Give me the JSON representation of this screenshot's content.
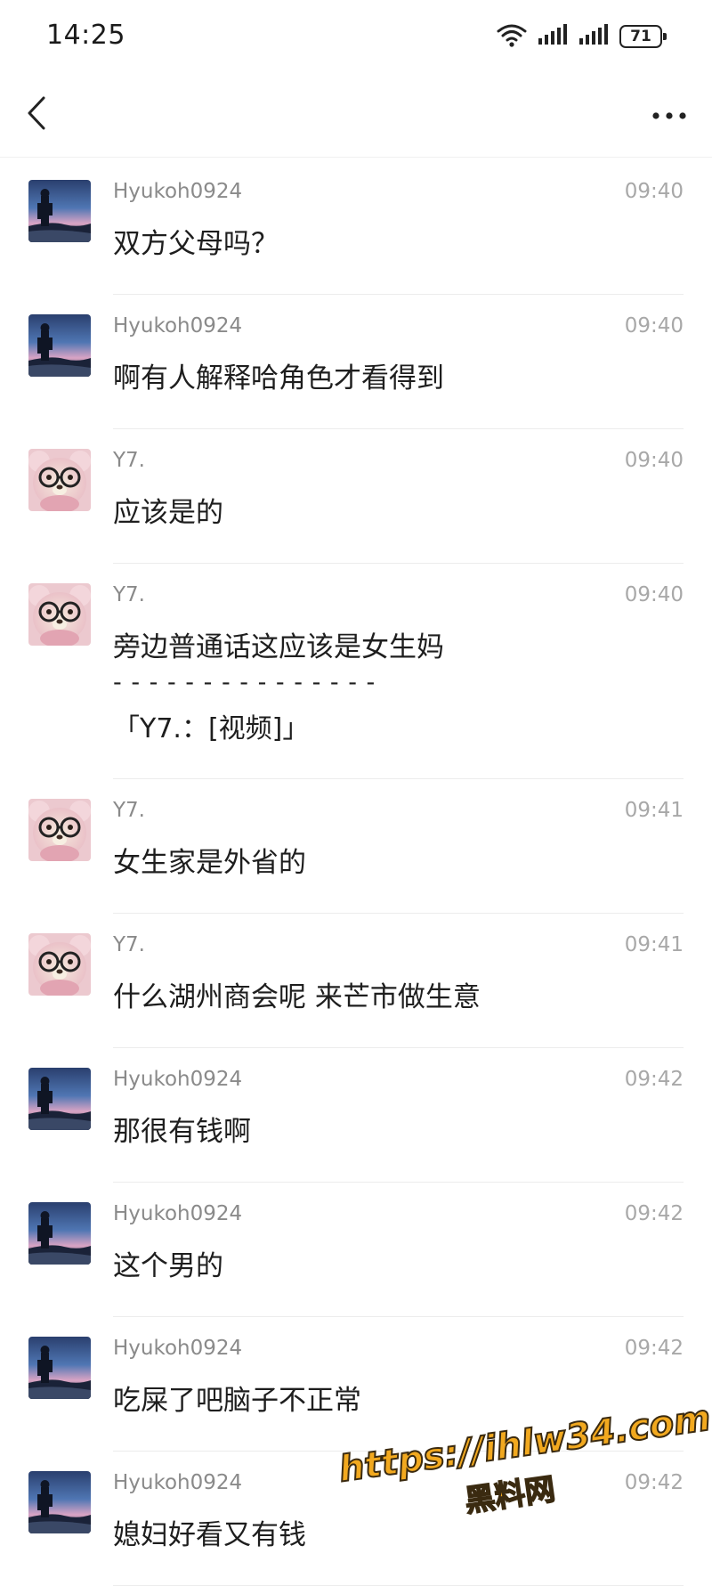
{
  "status_bar": {
    "time": "14:25",
    "battery": "71",
    "icons": [
      "wifi-icon",
      "signal-icon",
      "signal-icon",
      "battery-icon"
    ]
  },
  "nav": {
    "back_icon": "chevron-left-icon",
    "more_icon": "more-horizontal-icon"
  },
  "messages": [
    {
      "avatar": "hyukoh",
      "name": "Hyukoh0924",
      "time": "09:40",
      "text": "双方父母吗？"
    },
    {
      "avatar": "hyukoh",
      "name": "Hyukoh0924",
      "time": "09:40",
      "text": "啊有人解释哈角色才看得到"
    },
    {
      "avatar": "y7",
      "name": "Y7.",
      "time": "09:40",
      "text": "应该是的"
    },
    {
      "avatar": "y7",
      "name": "Y7.",
      "time": "09:40",
      "text": "旁边普通话这应该是女生妈",
      "separator": "- - - - - - - - - - - - - - -",
      "quote": "「Y7.：[视频]」"
    },
    {
      "avatar": "y7",
      "name": "Y7.",
      "time": "09:41",
      "text": "女生家是外省的"
    },
    {
      "avatar": "y7",
      "name": "Y7.",
      "time": "09:41",
      "text": "什么湖州商会呢 来芒市做生意"
    },
    {
      "avatar": "hyukoh",
      "name": "Hyukoh0924",
      "time": "09:42",
      "text": "那很有钱啊"
    },
    {
      "avatar": "hyukoh",
      "name": "Hyukoh0924",
      "time": "09:42",
      "text": "这个男的"
    },
    {
      "avatar": "hyukoh",
      "name": "Hyukoh0924",
      "time": "09:42",
      "text": "吃屎了吧脑子不正常"
    },
    {
      "avatar": "hyukoh",
      "name": "Hyukoh0924",
      "time": "09:42",
      "text": "媳妇好看又有钱"
    }
  ],
  "watermark": {
    "url": "https://ihlw34.com",
    "label": "黑料网"
  }
}
